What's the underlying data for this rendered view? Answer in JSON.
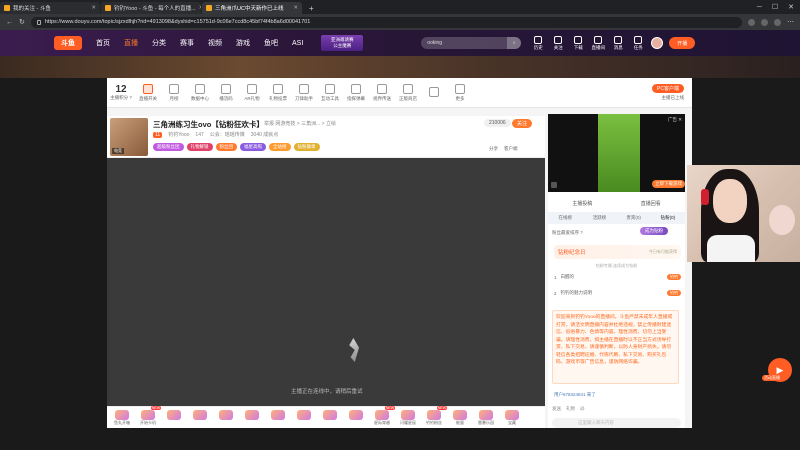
{
  "browser": {
    "tabs": [
      {
        "title": "我的关注 - 斗鱼",
        "active": false
      },
      {
        "title": "钓钓Yooo - 斗鱼 - 每个人的直播...",
        "active": false
      },
      {
        "title": "三角洲爪UC中天新作已上线",
        "active": true
      }
    ],
    "new_tab": "+",
    "url": "https://www.douyu.com/topic/sjzxdlhjh?rid=4913098&dyshid=c15751d-9c06e7ccd8c45bf74f4b8a6d00041701"
  },
  "header": {
    "logo": "斗鱼",
    "nav": [
      "首页",
      "直播",
      "分类",
      "赛事",
      "视频",
      "游戏",
      "鱼吧",
      "ASI"
    ],
    "promo": [
      "亚洲邀请赛",
      "公主魔赛"
    ],
    "search_placeholder": "ooking",
    "icons": [
      "历史",
      "关注",
      "下载",
      "直播间",
      "消息",
      "任务"
    ],
    "live_button": "开播"
  },
  "toolbar": {
    "level_number": "12",
    "level_label": "主播积分 ?",
    "tools": [
      "直播开关",
      "月榜",
      "数据中心",
      "播流码",
      "AR礼物",
      "礼物投票",
      "刀锋助手",
      "互动工具",
      "指挥弹幕",
      "视界传送",
      "正版商店",
      "",
      "更多"
    ],
    "pc_button": "PC客户端",
    "pc_sub": "主播已上线"
  },
  "room": {
    "title": "三角洲练习生ovo【钻粉狂欢卡】",
    "category": "举报    网游竞技 > 三角洲... > 立绘",
    "thumb_tag": "电竞",
    "streamer_level": "11",
    "streamer_name": "钓钓Yooo",
    "hot": "147",
    "notice": "公会：瑶瑶传媒",
    "fans_count": "3040 成就点",
    "badges": [
      {
        "text": "超级粉丝团",
        "color": "#c05ae0"
      },
      {
        "text": "礼物解锁",
        "color": "#e0406a"
      },
      {
        "text": "粉丝团",
        "color": "#ff7a2e"
      },
      {
        "text": "福星高照",
        "color": "#8a5ae0"
      },
      {
        "text": "全站榜",
        "color": "#ff9a2e"
      },
      {
        "text": "钻粉徽章",
        "color": "#e0b030"
      }
    ],
    "follow_count": "210006",
    "follow_label": "关注",
    "share": "分享",
    "report": "客户端"
  },
  "player": {
    "status": "主播正在连线中，请稍后重试"
  },
  "gift_bar": {
    "gifts": [
      {
        "name": "鱼丸开箱",
        "is_new": false
      },
      {
        "name": "开始卡机",
        "is_new": true
      },
      {
        "name": "",
        "is_new": false
      },
      {
        "name": "",
        "is_new": false
      },
      {
        "name": "",
        "is_new": false
      },
      {
        "name": "",
        "is_new": false
      },
      {
        "name": "",
        "is_new": false
      },
      {
        "name": "",
        "is_new": false
      },
      {
        "name": "",
        "is_new": false
      },
      {
        "name": "",
        "is_new": false
      },
      {
        "name": "星际穿越",
        "is_new": true
      },
      {
        "name": "闪耀星辰",
        "is_new": false
      },
      {
        "name": "钓钓粉丝",
        "is_new": true
      },
      {
        "name": "能量",
        "is_new": false
      },
      {
        "name": "雷暴乐园",
        "is_new": false
      },
      {
        "name": "宝藏",
        "is_new": false
      }
    ]
  },
  "right_panel": {
    "ad_label": "广告 ✕",
    "ad_download": "立即下载游戏",
    "tabs_top": [
      "主播投稿",
      "直播回看"
    ],
    "tabs": [
      "在线榜",
      "活跃榜",
      "贵宾(0)",
      "钻粉(0)"
    ],
    "rank_info": "粉丝最爱排序 ?",
    "rank_button": "成为钻粉",
    "fans_title": "钻粉纪念日",
    "fans_tip": "今日有可能获得",
    "fans_hint": "钻粉专属·连续成为钻粉",
    "fan_rows": [
      {
        "idx": "1",
        "text": "白醒的",
        "badge": "钓钓"
      },
      {
        "idx": "2",
        "text": "钓钓的魅力说明",
        "badge": "钓钓"
      }
    ],
    "chat_welcome": "欢迎来到钓钓Yooo的直播间。斗鱼严禁未成年人直播或打赏。请洁文明直播内容并杜绝违规，禁止传播封建迷信、低俗暴力、色情等内容。理性消费，切勿上当受骗。请理性消费，如主播在直播时以不正当方式诱导打赏、私下交易，请谨慎判断，以防人身财产损失。请勿轻信各类招聘征婚、代练代刷、私下交易、购买礼包码、游戏币等广告信息，谨防网络诈骗。",
    "chat_user": "用户678324841 来了",
    "chat_tools": [
      "发送",
      "礼物",
      "@"
    ],
    "chat_placeholder": "这里输入聊天内容"
  },
  "side": {
    "live_label": "活动直播"
  }
}
